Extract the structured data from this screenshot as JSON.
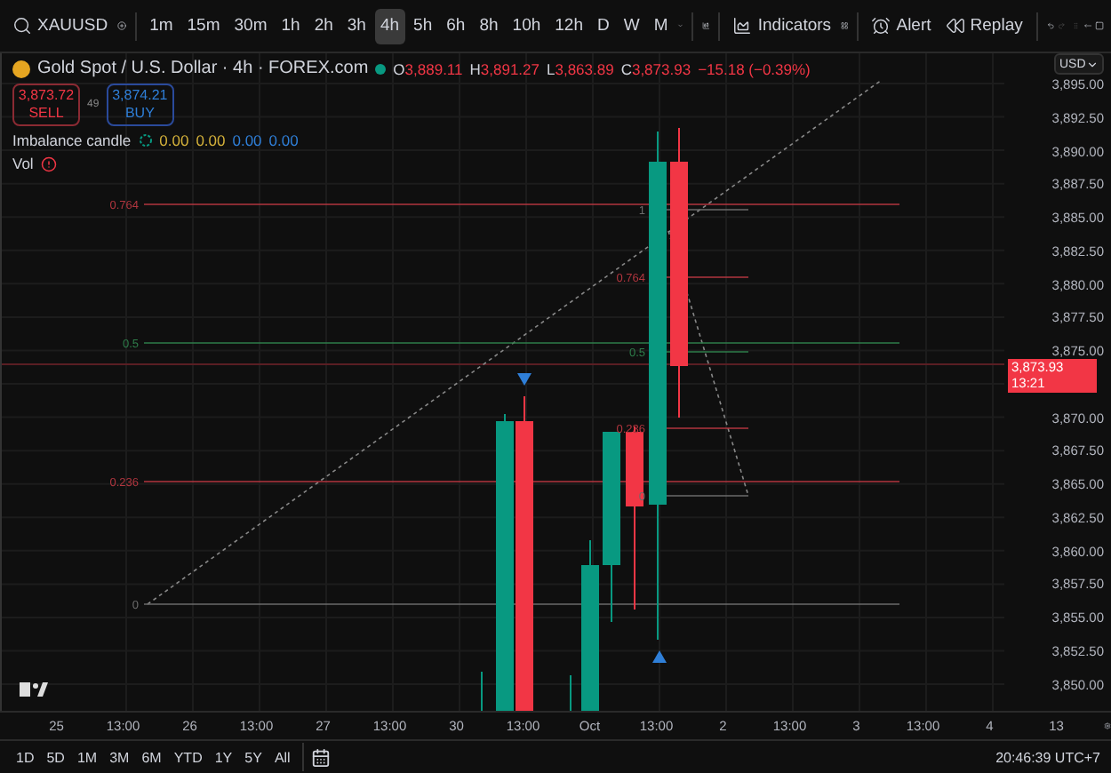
{
  "toolbar": {
    "symbol": "XAUUSD",
    "timeframes": [
      {
        "label": "1m",
        "selected": false
      },
      {
        "label": "15m",
        "selected": false
      },
      {
        "label": "30m",
        "selected": false
      },
      {
        "label": "1h",
        "selected": false
      },
      {
        "label": "2h",
        "selected": false
      },
      {
        "label": "3h",
        "selected": false
      },
      {
        "label": "4h",
        "selected": true
      },
      {
        "label": "5h",
        "selected": false
      },
      {
        "label": "6h",
        "selected": false
      },
      {
        "label": "8h",
        "selected": false
      },
      {
        "label": "10h",
        "selected": false
      },
      {
        "label": "12h",
        "selected": false
      },
      {
        "label": "D",
        "selected": false
      },
      {
        "label": "W",
        "selected": false
      },
      {
        "label": "M",
        "selected": false
      }
    ],
    "indicators": "Indicators",
    "alert": "Alert",
    "replay": "Replay"
  },
  "legend": {
    "title": "Gold Spot / U.S. Dollar · 4h · FOREX.com",
    "ohlc": [
      {
        "key": "O",
        "value": "3,889.11"
      },
      {
        "key": "H",
        "value": "3,891.27"
      },
      {
        "key": "L",
        "value": "3,863.89"
      },
      {
        "key": "C",
        "value": "3,873.93"
      }
    ],
    "change": "−15.18 (−0.39%)",
    "sell": {
      "price": "3,873.72",
      "label": "SELL"
    },
    "spread": "49",
    "buy": {
      "price": "3,874.21",
      "label": "BUY"
    },
    "indicator": {
      "name": "Imbalance candle",
      "values": [
        {
          "text": "0.00",
          "color": "#d4b13a"
        },
        {
          "text": "0.00",
          "color": "#d4b13a"
        },
        {
          "text": "0.00",
          "color": "#2f7fd8"
        },
        {
          "text": "0.00",
          "color": "#2f7fd8"
        }
      ]
    },
    "volume": "Vol"
  },
  "fib_main": [
    {
      "label": "0.764",
      "color": "#b2363f"
    },
    {
      "label": "0.5",
      "color": "#2e7d4a"
    },
    {
      "label": "0.236",
      "color": "#b2363f"
    },
    {
      "label": "0",
      "color": "#6b6b6b"
    }
  ],
  "fib_small": [
    {
      "label": "1",
      "color": "#6b6b6b"
    },
    {
      "label": "0.764",
      "color": "#b2363f"
    },
    {
      "label": "0.5",
      "color": "#2e7d4a"
    },
    {
      "label": "0.236",
      "color": "#b2363f"
    },
    {
      "label": "0",
      "color": "#6b6b6b"
    }
  ],
  "price_axis": {
    "currency": "USD",
    "ticks": [
      "3,895.00",
      "3,892.50",
      "3,890.00",
      "3,887.50",
      "3,885.00",
      "3,882.50",
      "3,880.00",
      "3,877.50",
      "3,875.00",
      "3,870.00",
      "3,867.50",
      "3,865.00",
      "3,862.50",
      "3,860.00",
      "3,857.50",
      "3,855.00",
      "3,852.50",
      "3,850.00"
    ],
    "current_price": "3,873.93",
    "countdown": "13:21"
  },
  "time_axis": [
    "25",
    "13:00",
    "26",
    "13:00",
    "27",
    "13:00",
    "30",
    "13:00",
    "Oct",
    "13:00",
    "2",
    "13:00",
    "3",
    "13:00",
    "4",
    "13"
  ],
  "bottom_bar": {
    "ranges": [
      "1D",
      "5D",
      "1M",
      "3M",
      "6M",
      "YTD",
      "1Y",
      "5Y",
      "All"
    ],
    "clock": "20:46:39 UTC+7"
  }
}
